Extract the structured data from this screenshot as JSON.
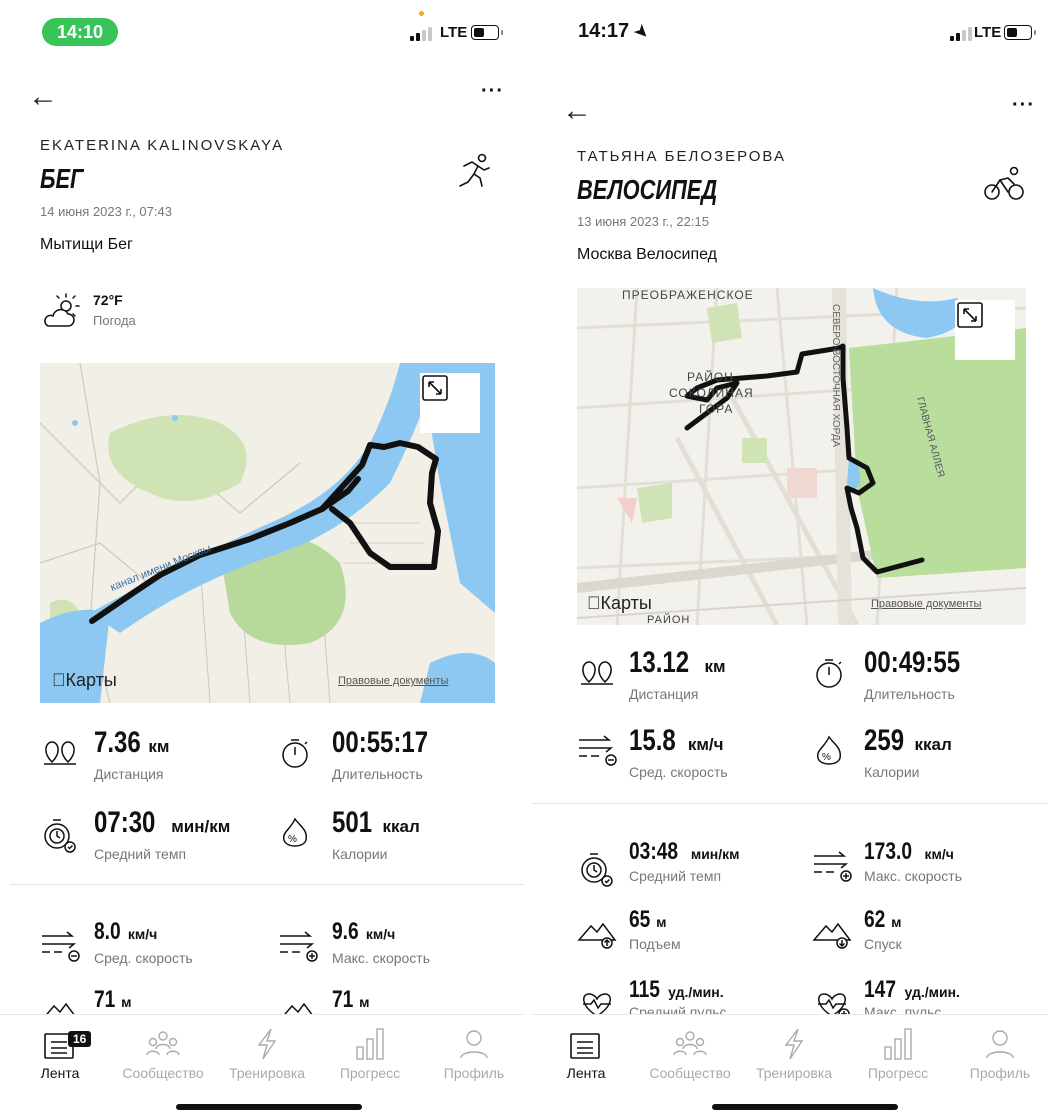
{
  "screens": [
    {
      "status": {
        "time": "14:10",
        "network": "LTE"
      },
      "author": "EKATERINA KALINOVSKAYA",
      "activity": "БЕГ",
      "date": "14 июня 2023 г., 07:43",
      "workout_name": "Мытищи Бег",
      "weather": {
        "temp": "72°F",
        "label": "Погода"
      },
      "map": {
        "maps_label": "Карты",
        "legal": "Правовые документы",
        "canal": "канал имени Москвы"
      },
      "stats": [
        {
          "value": "7.36",
          "unit": "км",
          "label": "Дистанция",
          "icon": "distance-icon"
        },
        {
          "value": "00:55:17",
          "unit": "",
          "label": "Длительность",
          "icon": "stopwatch-icon"
        },
        {
          "value": "07:30",
          "unit": "мин/км",
          "label": "Средний темп",
          "icon": "pace-icon"
        },
        {
          "value": "501",
          "unit": "ккал",
          "label": "Калории",
          "icon": "calories-icon"
        },
        {
          "value": "8.0",
          "unit": "км/ч",
          "label": "Сред. скорость",
          "icon": "avg-speed-icon"
        },
        {
          "value": "9.6",
          "unit": "км/ч",
          "label": "Макс. скорость",
          "icon": "max-speed-icon"
        },
        {
          "value": "71",
          "unit": "м",
          "label": "",
          "icon": "ascent-icon"
        },
        {
          "value": "71",
          "unit": "м",
          "label": "",
          "icon": "descent-icon"
        }
      ],
      "tabs": [
        {
          "label": "Лента",
          "active": true,
          "badge": "16"
        },
        {
          "label": "Сообщество"
        },
        {
          "label": "Тренировка"
        },
        {
          "label": "Прогресс"
        },
        {
          "label": "Профиль"
        }
      ]
    },
    {
      "status": {
        "time": "14:17",
        "network": "LTE"
      },
      "author": "ТАТЬЯНА БЕЛОЗЕРОВА",
      "activity": "ВЕЛОСИПЕД",
      "date": "13 июня 2023 г., 22:15",
      "workout_name": "Москва Велосипед",
      "map": {
        "maps_label": "Карты",
        "legal": "Правовые документы",
        "district1": "ПРЕОБРАЖЕНСКОЕ",
        "district2": "РАЙОН",
        "district3": "СОКОЛИНАЯ",
        "district4": "ГОРА",
        "road1": "СЕВЕРО-ВОСТОЧНАЯ ХОРДА",
        "road2": "ГЛАВНАЯ АЛЛЕЯ",
        "district5": "РАЙОН"
      },
      "stats": [
        {
          "value": "13.12",
          "unit": "км",
          "label": "Дистанция",
          "icon": "distance-icon"
        },
        {
          "value": "00:49:55",
          "unit": "",
          "label": "Длительность",
          "icon": "stopwatch-icon"
        },
        {
          "value": "15.8",
          "unit": "км/ч",
          "label": "Сред. скорость",
          "icon": "avg-speed-icon"
        },
        {
          "value": "259",
          "unit": "ккал",
          "label": "Калории",
          "icon": "calories-icon"
        },
        {
          "value": "03:48",
          "unit": "мин/км",
          "label": "Средний темп",
          "icon": "pace-icon"
        },
        {
          "value": "173.0",
          "unit": "км/ч",
          "label": "Макс. скорость",
          "icon": "max-speed-icon"
        },
        {
          "value": "65",
          "unit": "м",
          "label": "Подъем",
          "icon": "ascent-icon"
        },
        {
          "value": "62",
          "unit": "м",
          "label": "Спуск",
          "icon": "descent-icon"
        },
        {
          "value": "115",
          "unit": "уд./мин.",
          "label": "Средний пульс",
          "icon": "heart-rate-icon"
        },
        {
          "value": "147",
          "unit": "уд./мин.",
          "label": "Макс. пульс",
          "icon": "max-heart-rate-icon"
        }
      ],
      "tabs": [
        {
          "label": "Лента",
          "active": true
        },
        {
          "label": "Сообщество"
        },
        {
          "label": "Тренировка"
        },
        {
          "label": "Прогресс"
        },
        {
          "label": "Профиль"
        }
      ]
    }
  ]
}
